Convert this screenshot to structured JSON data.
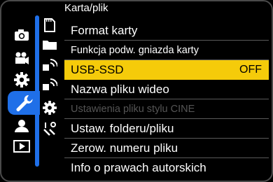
{
  "header": {
    "title": "Karta/plik"
  },
  "main_tabs": [
    {
      "icon": "camera-icon"
    },
    {
      "icon": "video-camera-icon"
    },
    {
      "icon": "gear-icon"
    },
    {
      "icon": "wrench-icon",
      "selected": true
    },
    {
      "icon": "person-icon"
    },
    {
      "icon": "playback-icon"
    }
  ],
  "sub_tabs": [
    {
      "icon": "sd-card-icon",
      "selected": true
    },
    {
      "icon": "folder-icon"
    },
    {
      "icon": "wireless-1-icon"
    },
    {
      "icon": "wireless-2-icon"
    },
    {
      "icon": "gear-icon"
    },
    {
      "icon": "tools-icon"
    }
  ],
  "menu": {
    "items": [
      {
        "label": "Format karty",
        "value": ""
      },
      {
        "label": "Funkcja podw. gniazda karty",
        "value": ""
      },
      {
        "label": "USB-SSD",
        "value": "OFF",
        "selected": true
      },
      {
        "label": "Nazwa pliku wideo",
        "value": ""
      },
      {
        "label": "Ustawienia pliku stylu CINE",
        "value": "",
        "disabled": true
      },
      {
        "label": "Ustaw. folderu/pliku",
        "value": ""
      },
      {
        "label": "Zerow. numeru pliku",
        "value": ""
      },
      {
        "label": "Info o prawach autorskich",
        "value": ""
      }
    ]
  },
  "colors": {
    "accent_blue": "#1f6fe8",
    "selection_yellow": "#f5cb0a",
    "text": "#ffffff",
    "disabled_text": "#555555"
  }
}
